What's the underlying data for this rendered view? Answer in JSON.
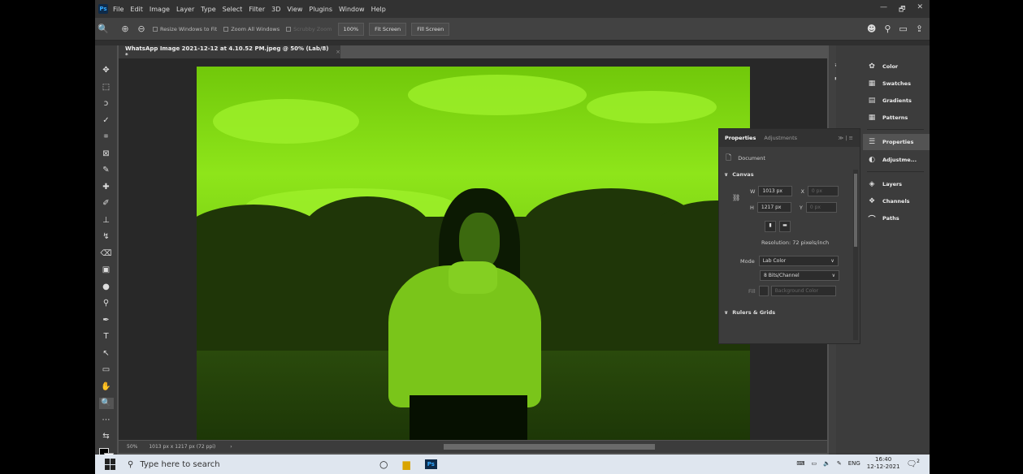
{
  "menubar": {
    "logo": "Ps",
    "items": [
      "File",
      "Edit",
      "Image",
      "Layer",
      "Type",
      "Select",
      "Filter",
      "3D",
      "View",
      "Plugins",
      "Window",
      "Help"
    ]
  },
  "window_controls": [
    "—",
    "🗗",
    "✕"
  ],
  "options": {
    "resize_windows": "Resize Windows to Fit",
    "zoom_all": "Zoom All Windows",
    "scrubby": "Scrubby Zoom",
    "zoom_pct": "100%",
    "fit_screen": "Fit Screen",
    "fill_screen": "Fill Screen"
  },
  "doc_tab": {
    "title": "WhatsApp Image 2021-12-12 at 4.10.52 PM.jpeg @ 50% (Lab/8) *",
    "close": "×"
  },
  "properties": {
    "tab_properties": "Properties",
    "tab_adjustments": "Adjustments",
    "tab_icons": "≫ | ≡",
    "document_label": "Document",
    "canvas_label": "Canvas",
    "w_label": "W",
    "w_value": "1013 px",
    "x_label": "X",
    "x_value": "0 px",
    "h_label": "H",
    "h_value": "1217 px",
    "y_label": "Y",
    "y_value": "0 px",
    "resolution": "Resolution: 72 pixels/inch",
    "mode_label": "Mode",
    "mode_value": "Lab Color",
    "depth_value": "8 Bits/Channel",
    "fill_label": "Fill",
    "fill_value": "Background Color",
    "rulers_label": "Rulers & Grids"
  },
  "dock": {
    "items": [
      "Color",
      "Swatches",
      "Gradients",
      "Patterns",
      "Properties",
      "Adjustme...",
      "Layers",
      "Channels",
      "Paths"
    ]
  },
  "status": {
    "zoom": "50%",
    "doc_size": "1013 px x 1217 px (72 ppi)"
  },
  "taskbar": {
    "search_placeholder": "Type here to search",
    "lang": "ENG",
    "time": "16:40",
    "date": "12-12-2021",
    "notif_count": "2"
  }
}
